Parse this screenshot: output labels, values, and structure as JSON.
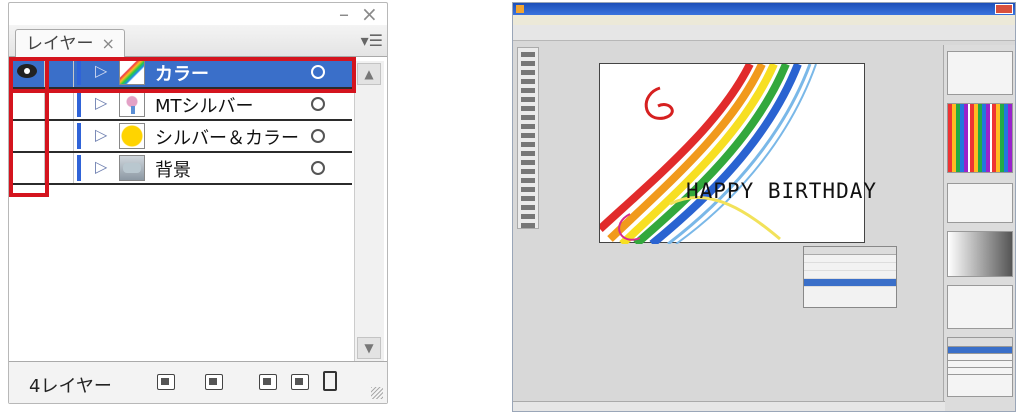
{
  "layers_panel": {
    "tab_label": "レイヤー",
    "tab_close": "×",
    "minimize": "–",
    "close": "×",
    "menu_icon": "panel-menu-icon",
    "layers": [
      {
        "name": "カラー",
        "selected": true,
        "visible": true,
        "thumbnail": "rainbow-thumbnail"
      },
      {
        "name": "MTシルバー",
        "selected": false,
        "visible": false,
        "thumbnail": "flower-thumbnail"
      },
      {
        "name": "シルバー＆カラー",
        "selected": false,
        "visible": false,
        "thumbnail": "star-thumbnail"
      },
      {
        "name": "背景",
        "selected": false,
        "visible": false,
        "thumbnail": "background-thumbnail"
      }
    ],
    "layer_count": "4レイヤー",
    "colors": {
      "selection": "#3a6fc9",
      "layer_color": "#2f63d8",
      "highlight_box": "#d4141e"
    }
  },
  "illustrator": {
    "artwork_text": "HAPPY BIRTHDAY",
    "colors": {
      "title_bar": "#1d4fb8",
      "selection": "#3a6fc9"
    }
  }
}
